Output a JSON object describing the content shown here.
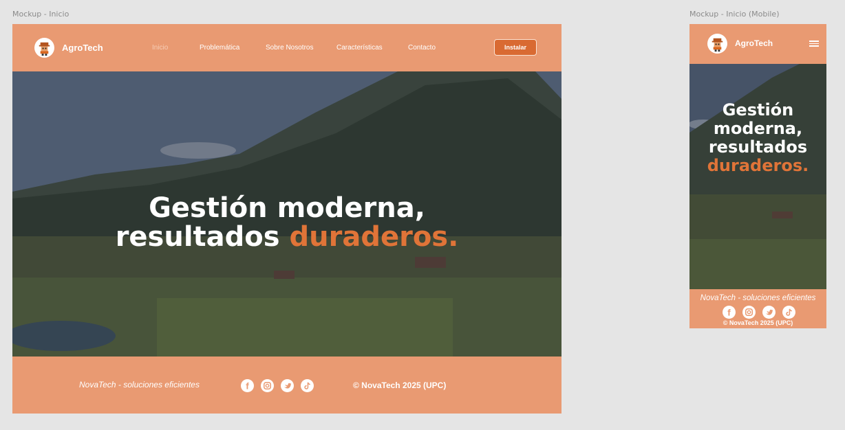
{
  "desktop": {
    "frame_label": "Mockup - Inicio",
    "brand": "AgroTech",
    "nav": [
      "Inicio",
      "Problemática",
      "Sobre Nosotros",
      "Características",
      "Contacto"
    ],
    "active_nav": "Inicio",
    "install_label": "Instalar",
    "hero": {
      "line1": "Gestión moderna,",
      "line2_plain": "resultados ",
      "line2_accent": "duraderos."
    },
    "footer": {
      "slogan": "NovaTech - soluciones eficientes",
      "copyright": "© NovaTech 2025 (UPC)"
    },
    "social_icons": [
      "facebook-icon",
      "instagram-icon",
      "twitter-icon",
      "tiktok-icon"
    ]
  },
  "mobile": {
    "frame_label": "Mockup - Inicio (Mobile)",
    "brand": "AgroTech",
    "hero": {
      "line1": "Gestión",
      "line2": "moderna,",
      "line3": "resultados",
      "line4_accent": "duraderos."
    },
    "footer": {
      "slogan": "NovaTech - soluciones eficientes",
      "copyright": "© NovaTech 2025 (UPC)"
    }
  },
  "colors": {
    "header_bg": "#e99a72",
    "accent": "#e07438",
    "install_bg": "#d96a32",
    "canvas": "#e5e5e5"
  }
}
